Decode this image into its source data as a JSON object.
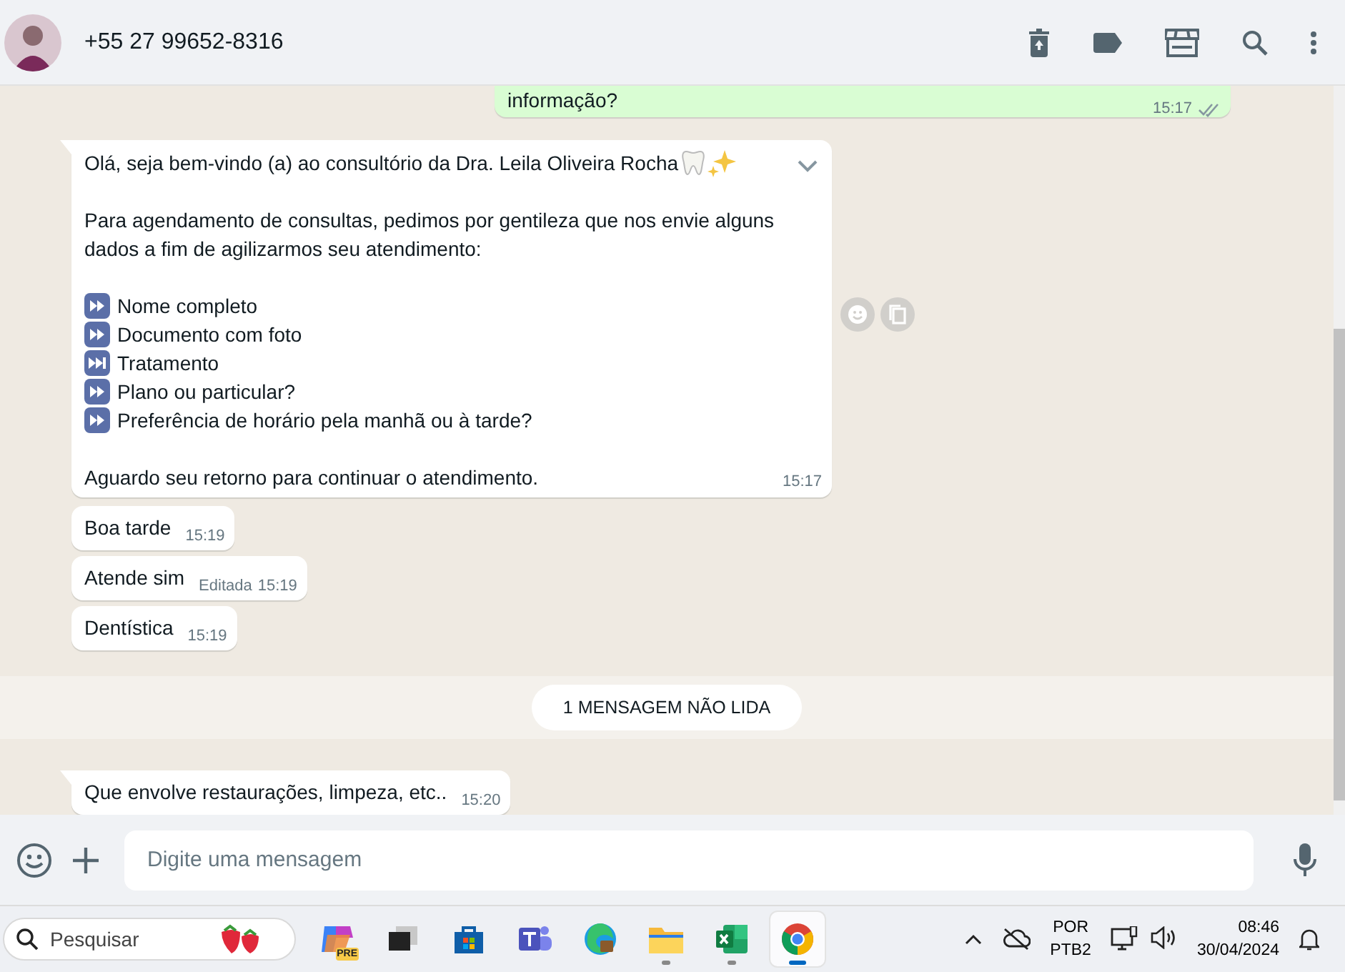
{
  "header": {
    "contact": "+55 27 99652-8316"
  },
  "messages": [
    {
      "kind": "outgoing",
      "text": "informação?",
      "time": "15:17",
      "read": false
    },
    {
      "kind": "incoming",
      "tail": true,
      "hovered": true,
      "time": "15:17",
      "blocks": [
        {
          "kind": "text",
          "text": "Olá, seja bem-vindo (a) ao consultório da Dra. Leila Oliveira Rocha",
          "emoji": [
            {
              "kind": "tooth"
            },
            {
              "kind": "sparkles"
            }
          ]
        },
        {
          "kind": "text",
          "text": "Para agendamento de consultas, pedimos por gentileza que nos envie alguns dados a fim de agilizarmos seu atendimento:"
        },
        {
          "kind": "list",
          "items": [
            {
              "kind": "fast-forward",
              "text": "Nome completo"
            },
            {
              "kind": "fast-forward",
              "text": "Documento com foto"
            },
            {
              "kind": "next-track",
              "text": "Tratamento"
            },
            {
              "kind": "fast-forward",
              "text": "Plano ou particular?"
            },
            {
              "kind": "fast-forward",
              "text": "Preferência de horário pela manhã ou à tarde?"
            }
          ]
        },
        {
          "kind": "text",
          "text": "Aguardo seu retorno para continuar o atendimento."
        }
      ]
    },
    {
      "kind": "incoming",
      "tail": false,
      "text": "Boa tarde",
      "time": "15:19"
    },
    {
      "kind": "incoming",
      "tail": false,
      "text": "Atende  sim",
      "edited": "Editada",
      "time": "15:19"
    },
    {
      "kind": "incoming",
      "tail": false,
      "text": "Dentística",
      "time": "15:19"
    },
    {
      "kind": "divider",
      "text": "1 MENSAGEM NÃO LIDA"
    },
    {
      "kind": "incoming",
      "tail": true,
      "text": "Que envolve restaurações,  limpeza, etc..",
      "time": "15:20"
    }
  ],
  "composer": {
    "placeholder": "Digite uma mensagem"
  },
  "taskbar": {
    "search": {
      "placeholder": "Pesquisar"
    },
    "apps": [
      {
        "kind": "copilot",
        "badge": "PRE",
        "running": false,
        "active": false
      },
      {
        "kind": "task-view",
        "running": false,
        "active": false
      },
      {
        "kind": "store",
        "running": false,
        "active": false
      },
      {
        "kind": "teams",
        "running": false,
        "active": false
      },
      {
        "kind": "edge",
        "running": false,
        "active": false
      },
      {
        "kind": "explorer",
        "running": true,
        "active": false
      },
      {
        "kind": "excel",
        "running": true,
        "active": false
      },
      {
        "kind": "chrome",
        "running": true,
        "active": true
      }
    ],
    "language": [
      "POR",
      "PTB2"
    ],
    "time": "08:46",
    "date": "30/04/2024"
  }
}
